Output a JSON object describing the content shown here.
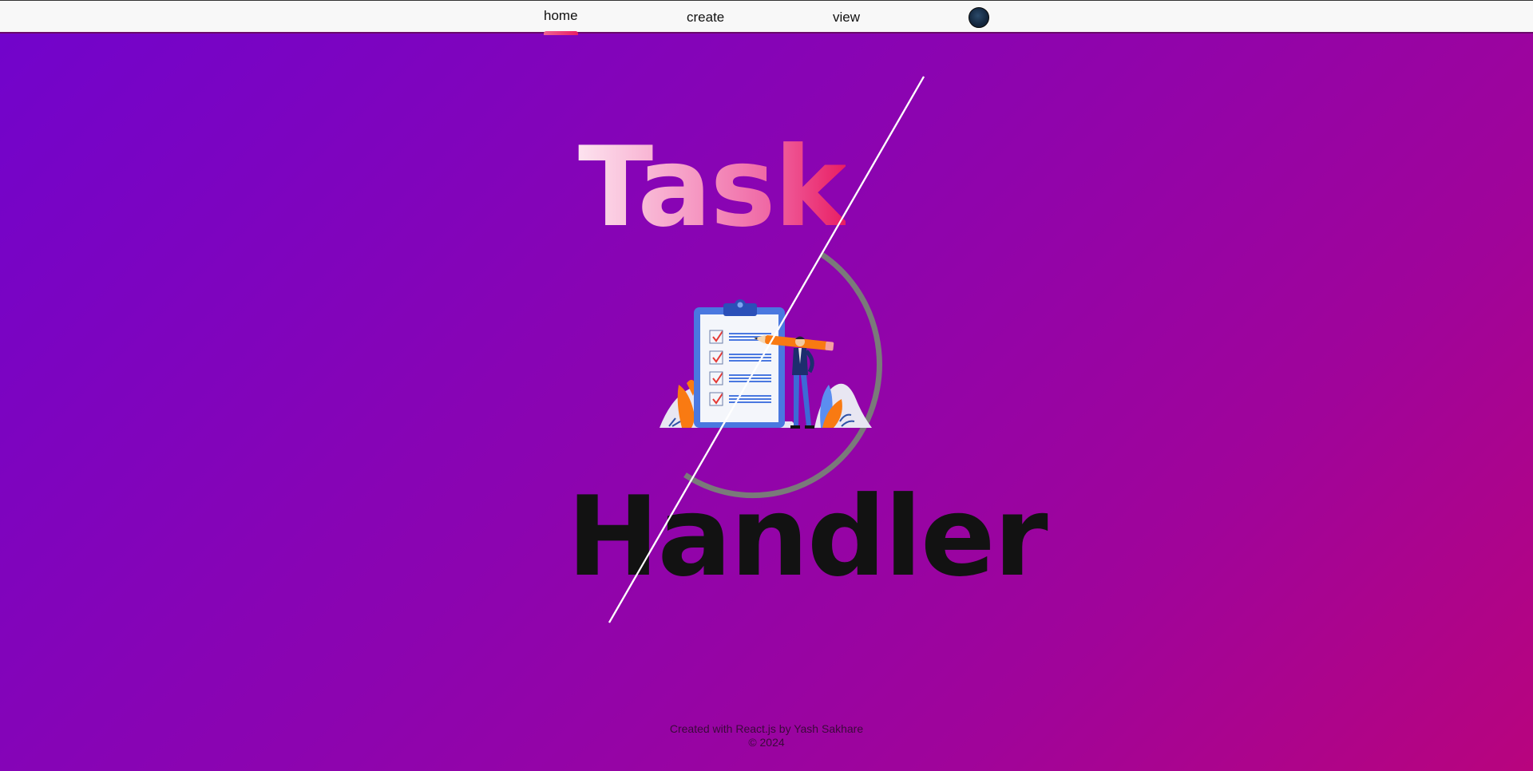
{
  "nav": {
    "home_label": "home",
    "create_label": "create",
    "view_label": "view",
    "active": "home",
    "theme_toggle_icon": "moon-icon"
  },
  "hero": {
    "title_top": "Task",
    "title_bottom": "Handler",
    "illustration": "checklist-clipboard-illustration"
  },
  "footer": {
    "credit": "Created with React.js by Yash Sakhare",
    "copyright": "© 2024"
  },
  "colors": {
    "background_start": "#7104cc",
    "background_end": "#b8047e",
    "accent": "#e91e63",
    "title_bottom": "#121212"
  }
}
